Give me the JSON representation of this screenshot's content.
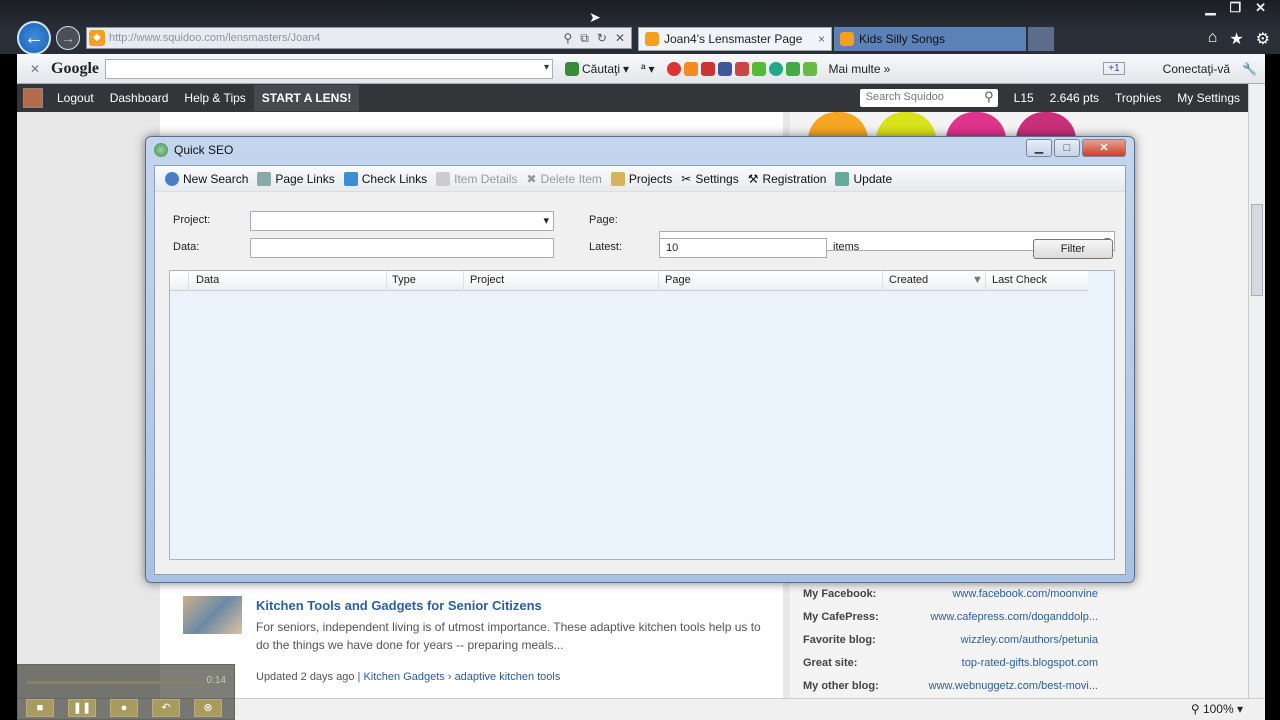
{
  "browser": {
    "address": "http://www.squidoo.com/lensmasters/Joan4",
    "tabs": [
      {
        "label": "Joan4's Lensmaster Page",
        "close": "×"
      },
      {
        "label": "Kids Silly Songs"
      }
    ],
    "win_controls": [
      "▁",
      "❐",
      "✕"
    ]
  },
  "google_toolbar": {
    "logo": "Google",
    "search_label": "Căutaţi",
    "more_label": "Mai multe",
    "more_icon": "»",
    "connect_label": "Conectaţi-vă",
    "plus_badge": "+1"
  },
  "squidoo_bar": {
    "logout": "Logout",
    "dashboard": "Dashboard",
    "help": "Help & Tips",
    "start": "START A LENS!",
    "search_placeholder": "Search Squidoo",
    "level": "L15",
    "points": "2.646 pts",
    "trophies": "Trophies",
    "settings": "My Settings"
  },
  "dialog": {
    "title": "Quick SEO",
    "toolbar": [
      {
        "label": "New Search",
        "enabled": true
      },
      {
        "label": "Page Links",
        "enabled": true
      },
      {
        "label": "Check Links",
        "enabled": true
      },
      {
        "label": "Item Details",
        "enabled": false
      },
      {
        "label": "Delete Item",
        "enabled": false
      },
      {
        "label": "Projects",
        "enabled": true
      },
      {
        "label": "Settings",
        "enabled": true
      },
      {
        "label": "Registration",
        "enabled": true
      },
      {
        "label": "Update",
        "enabled": true
      }
    ],
    "form": {
      "project_label": "Project:",
      "data_label": "Data:",
      "page_label": "Page:",
      "latest_label": "Latest:",
      "latest_value": "10",
      "items_label": "items",
      "filter_label": "Filter"
    },
    "columns": [
      "Data",
      "Type",
      "Project",
      "Page",
      "Created",
      "Last Check"
    ]
  },
  "lens": {
    "title": "Kitchen Tools and Gadgets for Senior Citizens",
    "desc": "For seniors, independent living is of utmost importance.  These adaptive kitchen tools help us to do the things we have done for years -- preparing meals...",
    "updated": "Updated 2 days ago | ",
    "tag1": "Kitchen Gadgets",
    "tag_sep": " › ",
    "tag2": "adaptive kitchen tools"
  },
  "sidebar": [
    {
      "label": "My Facebook:",
      "value": "www.facebook.com/moonvine"
    },
    {
      "label": "My CafePress:",
      "value": "www.cafepress.com/doganddolp..."
    },
    {
      "label": "Favorite blog:",
      "value": "wizzley.com/authors/petunia"
    },
    {
      "label": "Great site:",
      "value": "top-rated-gifts.blogspot.com"
    },
    {
      "label": "My other blog:",
      "value": "www.webnuggetz.com/best-movi..."
    }
  ],
  "player": {
    "time": "0:14"
  },
  "status": {
    "zoom": "100%"
  }
}
